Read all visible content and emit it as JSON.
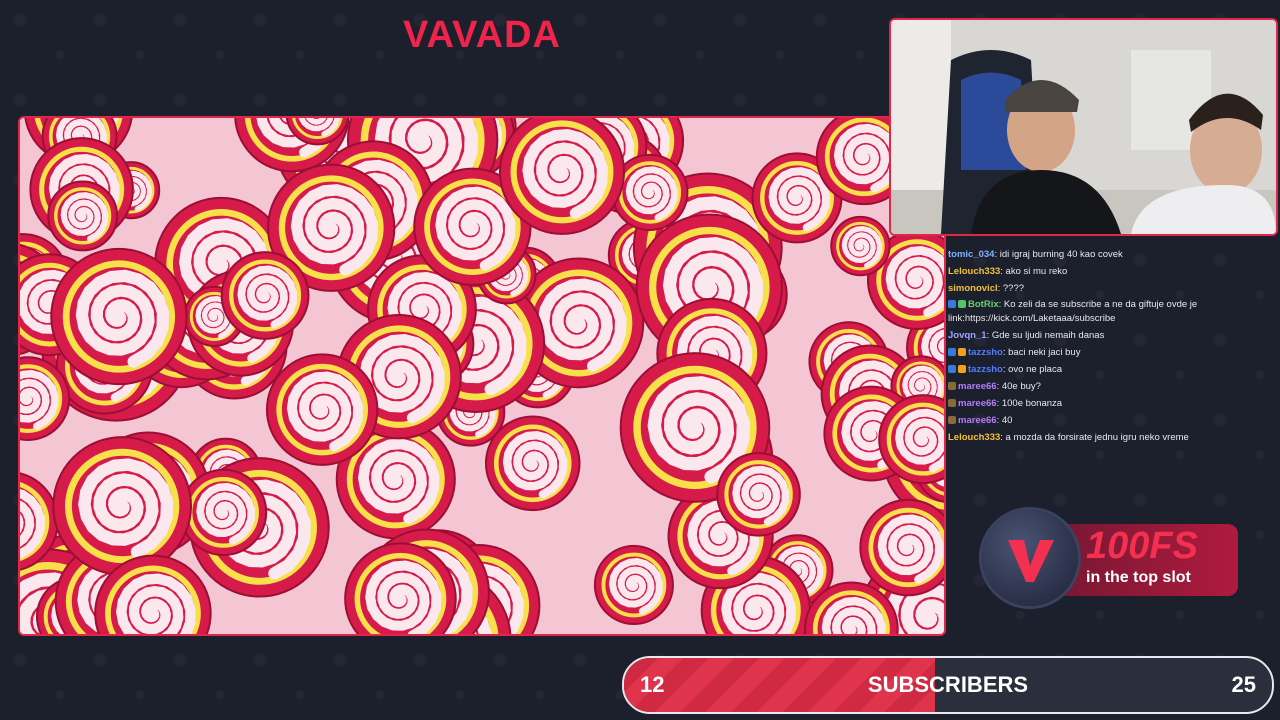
{
  "brand": {
    "name": "VAVADA"
  },
  "chat": {
    "messages": [
      {
        "user": "tomic_034",
        "color": "#7fb2ff",
        "text": ": idi igraj burning 40 kao covek",
        "badges": []
      },
      {
        "user": "Lelouch333",
        "color": "#f2c23a",
        "text": ": ako si mu reko",
        "badges": []
      },
      {
        "user": "simonovicl",
        "color": "#f2c23a",
        "text": ": ????",
        "badges": []
      },
      {
        "user": "BotRix",
        "color": "#64d36a",
        "text": ": Ko zeli da se subscribe a ne da giftuje ovde je link:https://kick.com/Laketaaa/subscribe",
        "badges": [
          "#3a7bd5",
          "#52c468"
        ]
      },
      {
        "user": "Jovqn_1",
        "color": "#9aa6ff",
        "text": ": Gde su ljudi nemaih danas",
        "badges": []
      },
      {
        "user": "tazzsho",
        "color": "#4f7dff",
        "text": ": baci neki jaci buy",
        "badges": [
          "#3a7bd5",
          "#f2a21a"
        ]
      },
      {
        "user": "tazzsho",
        "color": "#4f7dff",
        "text": ": ovo ne placa",
        "badges": [
          "#3a7bd5",
          "#f2a21a"
        ]
      },
      {
        "user": "maree66",
        "color": "#b57cff",
        "text": ": 40e buy?",
        "badges": [
          "#8a6a3a"
        ]
      },
      {
        "user": "maree66",
        "color": "#b57cff",
        "text": ": 100e bonanza",
        "badges": [
          "#8a6a3a"
        ]
      },
      {
        "user": "maree66",
        "color": "#b57cff",
        "text": ": 40",
        "badges": [
          "#8a6a3a"
        ]
      },
      {
        "user": "Lelouch333",
        "color": "#f2c23a",
        "text": ": a mozda da forsirate jednu igru neko vreme",
        "badges": []
      }
    ]
  },
  "promo": {
    "headline": "100FS",
    "subline": "in the top slot"
  },
  "subscribers": {
    "current": "12",
    "goal": "25",
    "label": "SUBSCRIBERS",
    "progress": 0.48
  },
  "colors": {
    "accent": "#e0264a",
    "background": "#1c1f2c"
  }
}
